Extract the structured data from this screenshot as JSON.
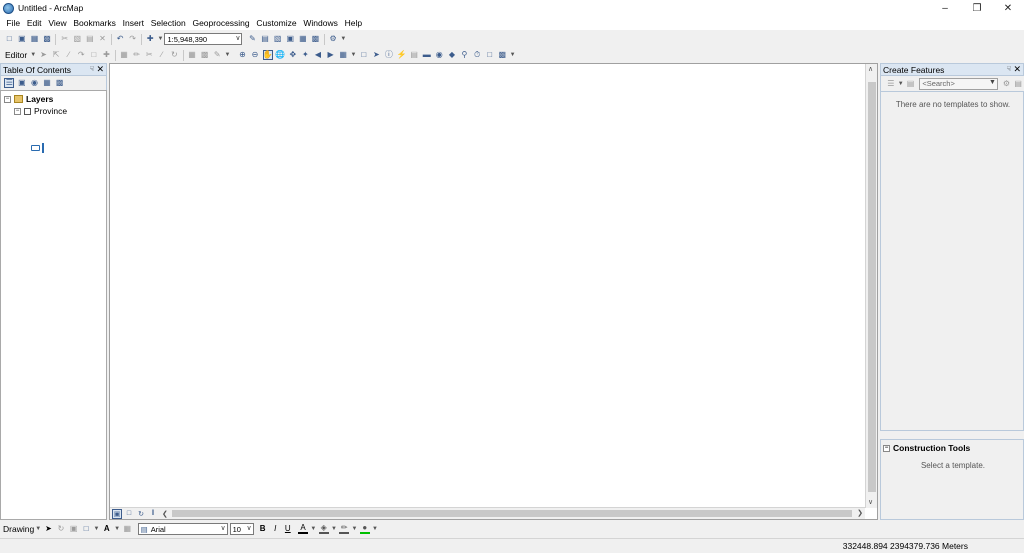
{
  "window": {
    "title": "Untitled - ArcMap"
  },
  "menu": [
    "File",
    "Edit",
    "View",
    "Bookmarks",
    "Insert",
    "Selection",
    "Geoprocessing",
    "Customize",
    "Windows",
    "Help"
  ],
  "standard_toolbar": {
    "scale": "1:5,948,390"
  },
  "editor_toolbar": {
    "editor_label": "Editor"
  },
  "toc": {
    "title": "Table Of Contents",
    "layers_label": "Layers",
    "layer_name": "Province"
  },
  "create_features": {
    "title": "Create Features",
    "search_placeholder": "<Search>",
    "empty_message": "There are no templates to show."
  },
  "construction_tools": {
    "title": "Construction Tools",
    "message": "Select a template."
  },
  "drawing_toolbar": {
    "label": "Drawing",
    "font": "Arial",
    "font_size": "10",
    "bold": "B",
    "italic": "I",
    "underline": "U",
    "text_tool": "A"
  },
  "status": {
    "coordinates": "332448.894  2394379.736 Meters"
  },
  "colors": {
    "panel_header": "#dbe6f2",
    "accent": "#2a6bb0"
  }
}
